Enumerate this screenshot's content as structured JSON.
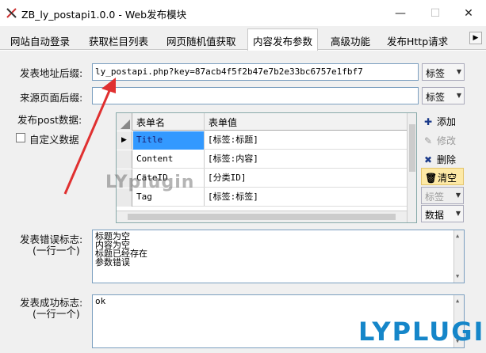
{
  "window": {
    "title": "ZB_ly_postapi1.0.0 - Web发布模块",
    "minimize": "—",
    "maximize": "☐",
    "close": "✕"
  },
  "tabs": [
    {
      "label": "网站自动登录"
    },
    {
      "label": "获取栏目列表"
    },
    {
      "label": "网页随机值获取"
    },
    {
      "label": "内容发布参数"
    },
    {
      "label": "高级功能"
    },
    {
      "label": "发布Http请求"
    }
  ],
  "active_tab": "内容发布参数",
  "form": {
    "post_url_label": "发表地址后缀:",
    "post_url_value": "ly_postapi.php?key=87acb4f5f2b47e7b2e33bc6757e1fbf7",
    "source_label": "来源页面后缀:",
    "source_value": "",
    "tag_combo": "标签",
    "post_data_label": "发布post数据:",
    "custom_data_label": "自定义数据"
  },
  "grid": {
    "columns": [
      "表单名",
      "表单值"
    ],
    "rows": [
      {
        "name": "Title",
        "value": "[标签:标题]"
      },
      {
        "name": "Content",
        "value": "[标签:内容]"
      },
      {
        "name": "CateID",
        "value": "[分类ID]"
      },
      {
        "name": "Tag",
        "value": "[标签:标签]"
      }
    ]
  },
  "side_buttons": {
    "add": "添加",
    "edit": "修改",
    "delete": "删除",
    "clear": "清空",
    "tag_combo": "标签",
    "data_combo": "数据"
  },
  "error_section": {
    "label_line1": "发表错误标志:",
    "label_line2": "(一行一个)",
    "lines": [
      "标题为空",
      "内容为空",
      "标题已经存在",
      "参数错误"
    ]
  },
  "success_section": {
    "label_line1": "发表成功标志:",
    "label_line2": "(一行一个)",
    "lines": [
      "ok"
    ]
  },
  "watermarks": {
    "grid_mark": "LYplugin",
    "corner_mark": "LYPLUGIN"
  },
  "colors": {
    "selection": "#3399ff",
    "annotation_arrow": "#e03030",
    "brand_blue": "#1586c9",
    "highlight_button": "#fde9a6"
  }
}
